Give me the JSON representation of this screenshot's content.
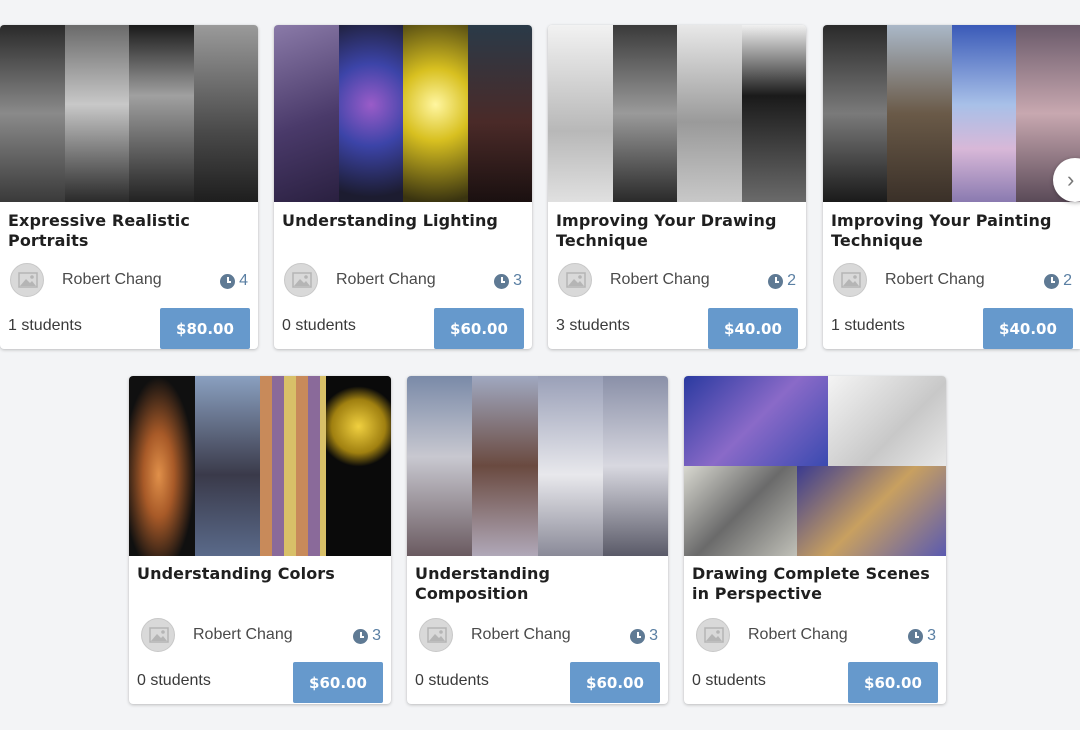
{
  "courses": [
    {
      "title": "Expressive Realistic Portraits",
      "author": "Robert Chang",
      "lessons": "4",
      "students": "1 students",
      "price": "$80.00",
      "thumb_colors": [
        "#3a3a3a",
        "#9a9a9a",
        "#2e2e2e",
        "#7c7c7c"
      ]
    },
    {
      "title": "Understanding Lighting",
      "author": "Robert Chang",
      "lessons": "3",
      "students": "0 students",
      "price": "$60.00",
      "thumb_colors": [
        "#6a5a8c",
        "#3b3f8c",
        "#c9b820",
        "#3a2a28"
      ]
    },
    {
      "title": "Improving Your Drawing Technique",
      "author": "Robert Chang",
      "lessons": "2",
      "students": "3 students",
      "price": "$40.00",
      "thumb_colors": [
        "#d8d8d8",
        "#5a5a5a",
        "#b8b8b8",
        "#2a2a2a"
      ]
    },
    {
      "title": "Improving Your Painting Technique",
      "author": "Robert Chang",
      "lessons": "2",
      "students": "1 students",
      "price": "$40.00",
      "thumb_colors": [
        "#4a4a4a",
        "#7a6a5a",
        "#8aa0d8",
        "#b8a8c0"
      ]
    },
    {
      "title": "Understanding Colors",
      "author": "Robert Chang",
      "lessons": "3",
      "students": "0 students",
      "price": "$60.00",
      "thumb_colors": [
        "#c07840",
        "#5a6a8a",
        "#c8a068",
        "#d8c020"
      ]
    },
    {
      "title": "Understanding Composition",
      "author": "Robert Chang",
      "lessons": "3",
      "students": "0 students",
      "price": "$60.00",
      "thumb_colors": [
        "#b8bccc",
        "#8a7a78",
        "#d0d0d8",
        "#9a9aa8"
      ]
    },
    {
      "title": "Drawing Complete Scenes in Perspective",
      "author": "Robert Chang",
      "lessons": "3",
      "students": "0 students",
      "price": "$60.00",
      "thumb_colors": [
        "#3a4aa8",
        "#e8e8e8",
        "#a8a898",
        "#5a5aa0"
      ]
    }
  ],
  "icons": {
    "avatar": "image-placeholder-icon",
    "lessons": "clock-icon",
    "next": "chevron-right-icon"
  },
  "colors": {
    "price_button": "#6699cc",
    "clock": "#5f7a94",
    "background": "#f3f4f6"
  }
}
